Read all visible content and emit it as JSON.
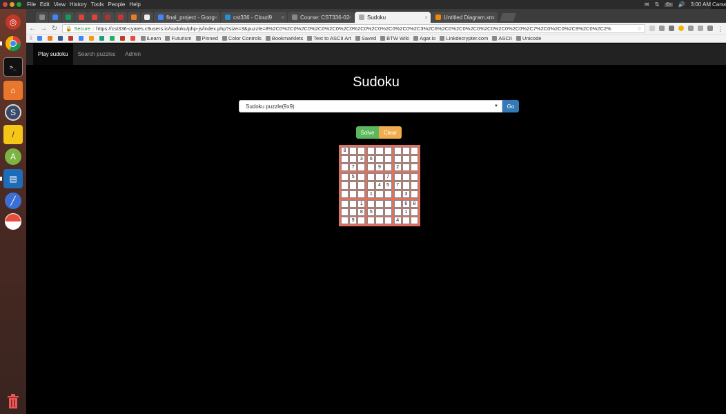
{
  "os": {
    "menu": [
      "File",
      "Edit",
      "View",
      "History",
      "Tools",
      "People",
      "Help"
    ],
    "time": "3:00 AM",
    "lang": "En",
    "user": "Carse"
  },
  "browser": {
    "tabs": [
      {
        "label": "final_project - Goog",
        "color": "#4285f4"
      },
      {
        "label": "cst336 - Cloud9",
        "color": "#2b8dd3"
      },
      {
        "label": "Course: CST336-02",
        "color": "#888888"
      },
      {
        "label": "Sudoku",
        "color": "#aaaaaa",
        "active": true
      },
      {
        "label": "Untitled Diagram.xm",
        "color": "#f08705"
      }
    ],
    "secure_label": "Secure",
    "url": "https://cst336-cyates.c9users.io/sudoku/php-js/index.php?size=3&puzzle=8%2C0%2C0%2C0%2C0%2C0%2C0%2C0%2C0%2C0%2C0%2C3%2C6%2C0%2C0%2C0%2C0%2C0%2C0%2C7%2C0%2C0%2C9%2C0%2C2%",
    "bookmarks": [
      "iLearn",
      "Futurism",
      "Pinned",
      "Color Controls",
      "Bookmarklets",
      "Text to ASCII Art",
      "Saved",
      "BTW Wiki",
      "Agar.io",
      "Linkdecrypter.com",
      "ASCII",
      "Unicode"
    ]
  },
  "nav": {
    "play": "Play sudoku",
    "search": "Search puzzles",
    "admin": "Admin"
  },
  "page": {
    "title": "Sudoku",
    "select_value": "Sudoku puzzle(9x9)",
    "go": "Go",
    "solve": "Solve",
    "clear": "Clear"
  },
  "puzzle": [
    [
      "8",
      "",
      "",
      "",
      "",
      "",
      "",
      "",
      ""
    ],
    [
      "",
      "",
      "3",
      "6",
      "",
      "",
      "",
      "",
      ""
    ],
    [
      "",
      "7",
      "",
      "",
      "9",
      "",
      "2",
      "",
      ""
    ],
    [
      "",
      "5",
      "",
      "",
      "",
      "7",
      "",
      "",
      ""
    ],
    [
      "",
      "",
      "",
      "",
      "4",
      "5",
      "7",
      "",
      ""
    ],
    [
      "",
      "",
      "",
      "1",
      "",
      "",
      "",
      "3",
      ""
    ],
    [
      "",
      "",
      "1",
      "",
      "",
      "",
      "",
      "6",
      "8"
    ],
    [
      "",
      "",
      "8",
      "5",
      "",
      "",
      "",
      "1",
      ""
    ],
    [
      "",
      "9",
      "",
      "",
      "",
      "",
      "4",
      "",
      ""
    ]
  ]
}
